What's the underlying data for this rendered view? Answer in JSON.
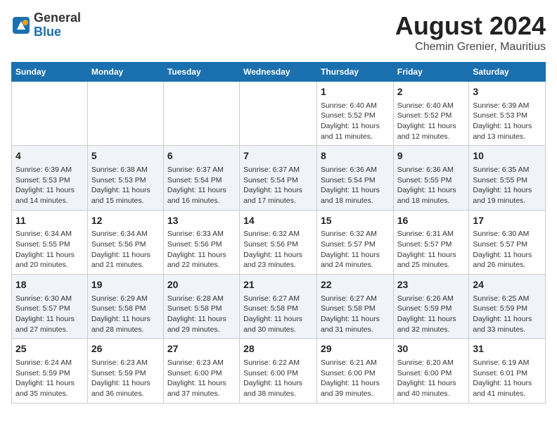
{
  "logo": {
    "general": "General",
    "blue": "Blue"
  },
  "title": "August 2024",
  "subtitle": "Chemin Grenier, Mauritius",
  "days_of_week": [
    "Sunday",
    "Monday",
    "Tuesday",
    "Wednesday",
    "Thursday",
    "Friday",
    "Saturday"
  ],
  "weeks": [
    [
      {
        "day": "",
        "info": ""
      },
      {
        "day": "",
        "info": ""
      },
      {
        "day": "",
        "info": ""
      },
      {
        "day": "",
        "info": ""
      },
      {
        "day": "1",
        "info": "Sunrise: 6:40 AM\nSunset: 5:52 PM\nDaylight: 11 hours and 11 minutes."
      },
      {
        "day": "2",
        "info": "Sunrise: 6:40 AM\nSunset: 5:52 PM\nDaylight: 11 hours and 12 minutes."
      },
      {
        "day": "3",
        "info": "Sunrise: 6:39 AM\nSunset: 5:53 PM\nDaylight: 11 hours and 13 minutes."
      }
    ],
    [
      {
        "day": "4",
        "info": "Sunrise: 6:39 AM\nSunset: 5:53 PM\nDaylight: 11 hours and 14 minutes."
      },
      {
        "day": "5",
        "info": "Sunrise: 6:38 AM\nSunset: 5:53 PM\nDaylight: 11 hours and 15 minutes."
      },
      {
        "day": "6",
        "info": "Sunrise: 6:37 AM\nSunset: 5:54 PM\nDaylight: 11 hours and 16 minutes."
      },
      {
        "day": "7",
        "info": "Sunrise: 6:37 AM\nSunset: 5:54 PM\nDaylight: 11 hours and 17 minutes."
      },
      {
        "day": "8",
        "info": "Sunrise: 6:36 AM\nSunset: 5:54 PM\nDaylight: 11 hours and 18 minutes."
      },
      {
        "day": "9",
        "info": "Sunrise: 6:36 AM\nSunset: 5:55 PM\nDaylight: 11 hours and 18 minutes."
      },
      {
        "day": "10",
        "info": "Sunrise: 6:35 AM\nSunset: 5:55 PM\nDaylight: 11 hours and 19 minutes."
      }
    ],
    [
      {
        "day": "11",
        "info": "Sunrise: 6:34 AM\nSunset: 5:55 PM\nDaylight: 11 hours and 20 minutes."
      },
      {
        "day": "12",
        "info": "Sunrise: 6:34 AM\nSunset: 5:56 PM\nDaylight: 11 hours and 21 minutes."
      },
      {
        "day": "13",
        "info": "Sunrise: 6:33 AM\nSunset: 5:56 PM\nDaylight: 11 hours and 22 minutes."
      },
      {
        "day": "14",
        "info": "Sunrise: 6:32 AM\nSunset: 5:56 PM\nDaylight: 11 hours and 23 minutes."
      },
      {
        "day": "15",
        "info": "Sunrise: 6:32 AM\nSunset: 5:57 PM\nDaylight: 11 hours and 24 minutes."
      },
      {
        "day": "16",
        "info": "Sunrise: 6:31 AM\nSunset: 5:57 PM\nDaylight: 11 hours and 25 minutes."
      },
      {
        "day": "17",
        "info": "Sunrise: 6:30 AM\nSunset: 5:57 PM\nDaylight: 11 hours and 26 minutes."
      }
    ],
    [
      {
        "day": "18",
        "info": "Sunrise: 6:30 AM\nSunset: 5:57 PM\nDaylight: 11 hours and 27 minutes."
      },
      {
        "day": "19",
        "info": "Sunrise: 6:29 AM\nSunset: 5:58 PM\nDaylight: 11 hours and 28 minutes."
      },
      {
        "day": "20",
        "info": "Sunrise: 6:28 AM\nSunset: 5:58 PM\nDaylight: 11 hours and 29 minutes."
      },
      {
        "day": "21",
        "info": "Sunrise: 6:27 AM\nSunset: 5:58 PM\nDaylight: 11 hours and 30 minutes."
      },
      {
        "day": "22",
        "info": "Sunrise: 6:27 AM\nSunset: 5:58 PM\nDaylight: 11 hours and 31 minutes."
      },
      {
        "day": "23",
        "info": "Sunrise: 6:26 AM\nSunset: 5:59 PM\nDaylight: 11 hours and 32 minutes."
      },
      {
        "day": "24",
        "info": "Sunrise: 6:25 AM\nSunset: 5:59 PM\nDaylight: 11 hours and 33 minutes."
      }
    ],
    [
      {
        "day": "25",
        "info": "Sunrise: 6:24 AM\nSunset: 5:59 PM\nDaylight: 11 hours and 35 minutes."
      },
      {
        "day": "26",
        "info": "Sunrise: 6:23 AM\nSunset: 5:59 PM\nDaylight: 11 hours and 36 minutes."
      },
      {
        "day": "27",
        "info": "Sunrise: 6:23 AM\nSunset: 6:00 PM\nDaylight: 11 hours and 37 minutes."
      },
      {
        "day": "28",
        "info": "Sunrise: 6:22 AM\nSunset: 6:00 PM\nDaylight: 11 hours and 38 minutes."
      },
      {
        "day": "29",
        "info": "Sunrise: 6:21 AM\nSunset: 6:00 PM\nDaylight: 11 hours and 39 minutes."
      },
      {
        "day": "30",
        "info": "Sunrise: 6:20 AM\nSunset: 6:00 PM\nDaylight: 11 hours and 40 minutes."
      },
      {
        "day": "31",
        "info": "Sunrise: 6:19 AM\nSunset: 6:01 PM\nDaylight: 11 hours and 41 minutes."
      }
    ]
  ]
}
